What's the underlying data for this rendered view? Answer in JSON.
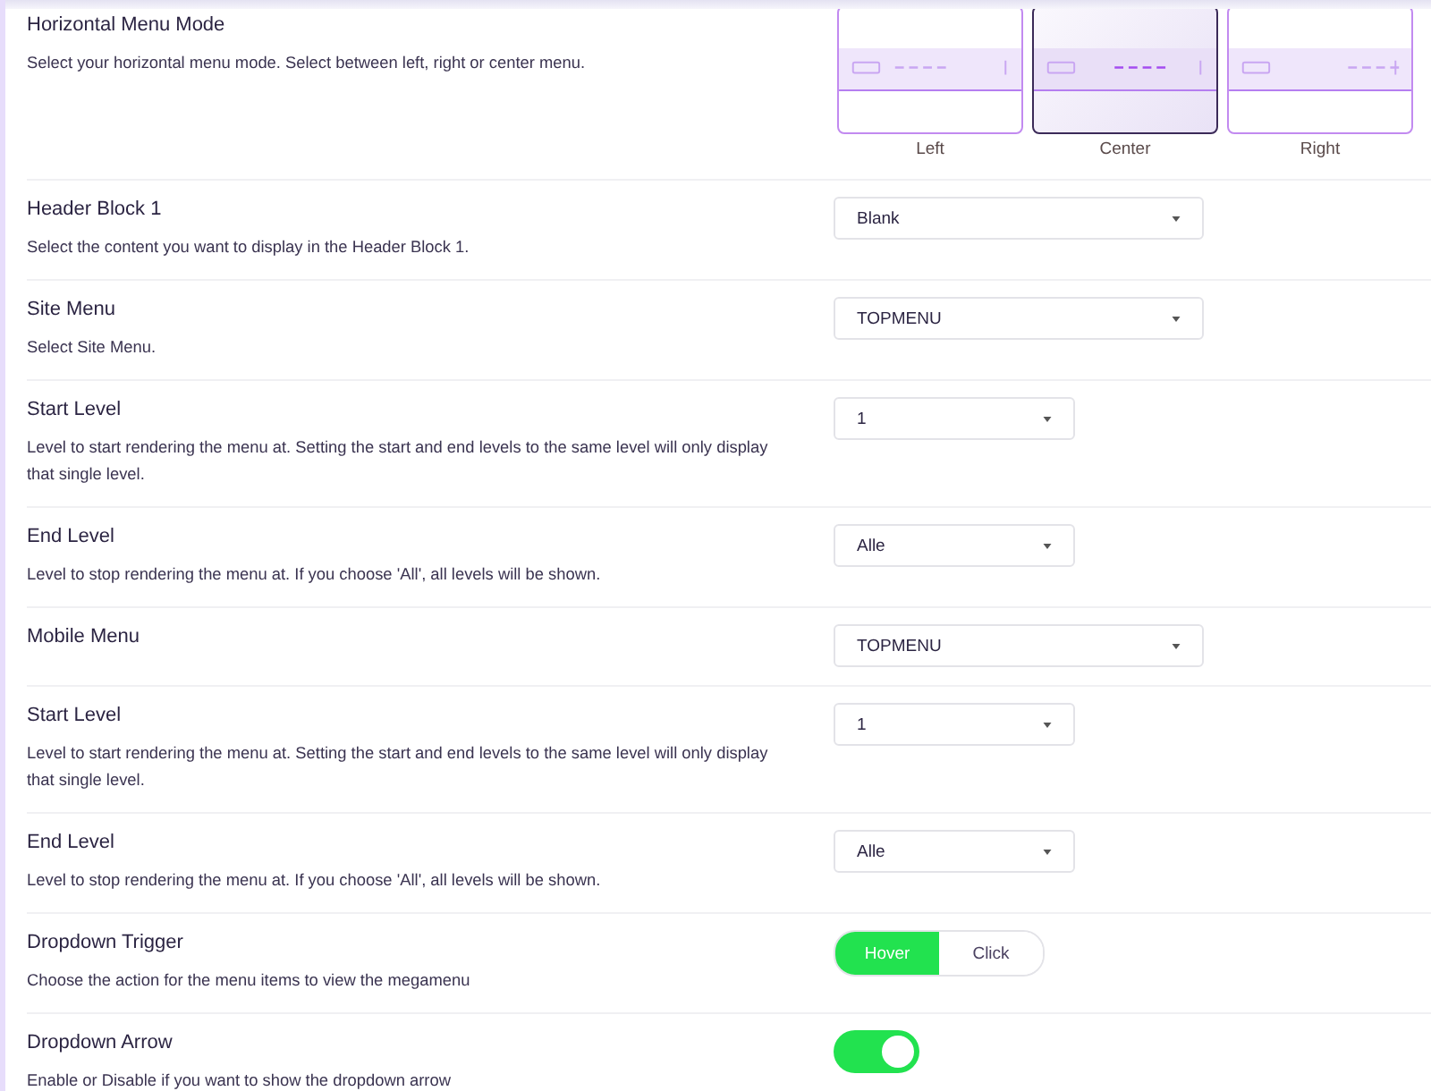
{
  "settings": [
    {
      "title": "Horizontal Menu Mode",
      "description": "Select your horizontal menu mode. Select between left, right or center menu.",
      "control": {
        "kind": "layout",
        "options": [
          {
            "label": "Left",
            "kind": "left",
            "selected": false
          },
          {
            "label": "Center",
            "kind": "center",
            "selected": true
          },
          {
            "label": "Right",
            "kind": "right",
            "selected": false
          }
        ]
      }
    },
    {
      "title": "Header Block 1",
      "description": "Select the content you want to display in the Header Block 1.",
      "control": {
        "kind": "select",
        "value": "Blank"
      }
    },
    {
      "title": "Site Menu",
      "description": "Select Site Menu.",
      "control": {
        "kind": "select",
        "value": "TOPMENU"
      }
    },
    {
      "title": "Start Level",
      "description": "Level to start rendering the menu at. Setting the start and end levels to the same level will only display that single level.",
      "control": {
        "kind": "shortselect",
        "value": "1"
      }
    },
    {
      "title": "End Level",
      "description": "Level to stop rendering the menu at. If you choose 'All', all levels will be shown.",
      "control": {
        "kind": "shortselect",
        "value": "Alle"
      }
    },
    {
      "title": "Mobile Menu",
      "control": {
        "kind": "select",
        "value": "TOPMENU"
      }
    },
    {
      "title": "Start Level",
      "description": "Level to start rendering the menu at. Setting the start and end levels to the same level will only display that single level.",
      "control": {
        "kind": "shortselect",
        "value": "1"
      }
    },
    {
      "title": "End Level",
      "description": "Level to stop rendering the menu at. If you choose 'All', all levels will be shown.",
      "control": {
        "kind": "shortselect",
        "value": "Alle"
      }
    },
    {
      "title": "Dropdown Trigger",
      "description": "Choose the action for the menu items to view the megamenu",
      "control": {
        "kind": "segmented",
        "options": [
          {
            "label": "Hover",
            "selected": true
          },
          {
            "label": "Click",
            "selected": false
          }
        ]
      }
    },
    {
      "title": "Dropdown Arrow",
      "description": "Enable or Disable if you want to show the dropdown arrow",
      "control": {
        "kind": "switch",
        "on": true
      }
    }
  ]
}
